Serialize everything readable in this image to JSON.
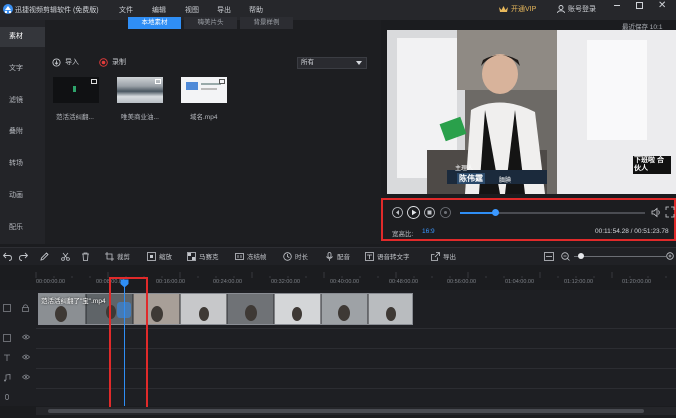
{
  "app": {
    "title": "迅捷视频剪辑软件 (免费版)",
    "menu": [
      "文件",
      "编辑",
      "视图",
      "导出",
      "帮助"
    ],
    "vip_label": "开通VIP",
    "login_label": "账号登录",
    "save_status": "最近保存 10:1"
  },
  "sidebar": {
    "items": [
      {
        "label": "素材",
        "active": true
      },
      {
        "label": "文字"
      },
      {
        "label": "滤镜"
      },
      {
        "label": "叠附"
      },
      {
        "label": "转场"
      },
      {
        "label": "动画"
      },
      {
        "label": "配乐"
      }
    ]
  },
  "media": {
    "tabs": [
      "本地素材",
      "嗨美片头",
      "背景样例"
    ],
    "import_label": "导入",
    "record_label": "录制",
    "filter_value": "所有",
    "items": [
      {
        "label": "范活活纠翻..."
      },
      {
        "label": "唯美商业油..."
      },
      {
        "label": "域名.mp4"
      }
    ]
  },
  "preview": {
    "caption_role": "主理人",
    "caption_name": "陈伟霆",
    "caption_tag": "腼腆",
    "corner_logo": "下班啦 合伙人"
  },
  "player": {
    "aspect_label": "宽高比:",
    "aspect_value": "16:9",
    "time": "00:11:54.28 / 00:51:23.78",
    "progress": 0.19
  },
  "toolbar": {
    "items": [
      "裁剪",
      "缩放",
      "马赛克",
      "冻结帧",
      "时长",
      "配音",
      "语音转文字",
      "导出"
    ]
  },
  "timeline": {
    "ruler": [
      "00:00:00.00",
      "00:08:00.00",
      "00:16:00.00",
      "00:24:00.00",
      "00:32:00.00",
      "00:40:00.00",
      "00:48:00.00",
      "00:56:00.00",
      "01:04:00.00",
      "01:12:00.00",
      "01:20:00.00"
    ],
    "clip_title": "范活活纠翻了\"宝\".mp4"
  },
  "colors": {
    "accent": "#2f8ef5",
    "highlight_red": "#e02a2a",
    "vip_gold": "#e8b85b"
  }
}
